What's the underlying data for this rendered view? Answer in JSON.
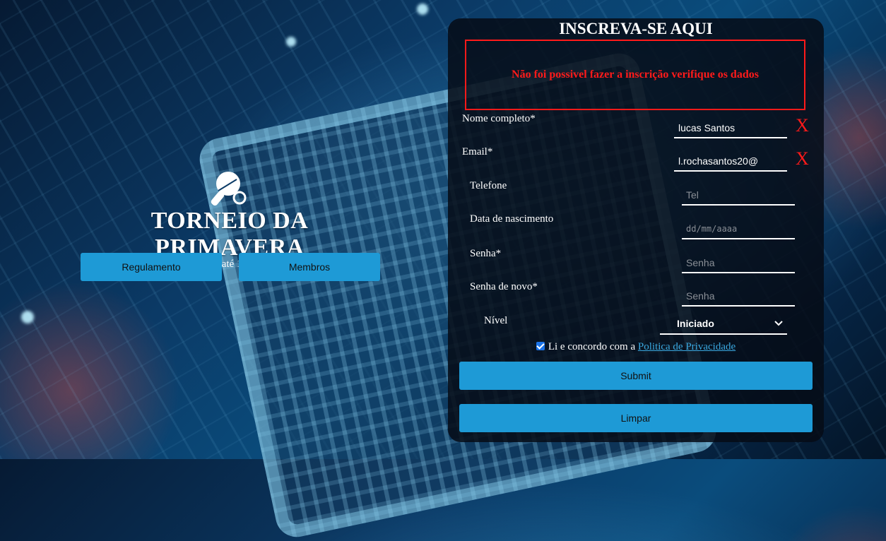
{
  "hero": {
    "title": "TORNEIO DA PRIMAVERA",
    "subtitle": "Prémios até 10º lugar",
    "buttons": {
      "regulamento": "Regulamento",
      "membros": "Membros"
    }
  },
  "form": {
    "title": "INSCREVA-SE AQUI",
    "error_message": "Não foi possivel fazer a inscrição verifique os dados",
    "fields": {
      "nome": {
        "label": "Nome completo*",
        "value": "lucas Santos",
        "invalid_mark": "X"
      },
      "email": {
        "label": "Email*",
        "value": "l.rochasantos20@",
        "invalid_mark": "X"
      },
      "telefone": {
        "label": "Telefone",
        "placeholder": "Tel"
      },
      "nascimento": {
        "label": "Data de nascimento",
        "placeholder": "dd/mm/aaaa"
      },
      "senha": {
        "label": "Senha*",
        "placeholder": "Senha"
      },
      "senha_novo": {
        "label": "Senha de novo*",
        "placeholder": "Senha"
      },
      "nivel": {
        "label": "Nível",
        "selected": "Iniciado"
      }
    },
    "consent": {
      "text": "Li e concordo com a",
      "link": "Politica de Privacidade",
      "checked": true
    },
    "submit_label": "Submit",
    "clear_label": "Limpar"
  },
  "colors": {
    "accent": "#1e9ad6",
    "error": "#ff1a1a",
    "panel": "#060c16"
  },
  "icons": {
    "hero": "ping-pong-paddle-icon"
  }
}
